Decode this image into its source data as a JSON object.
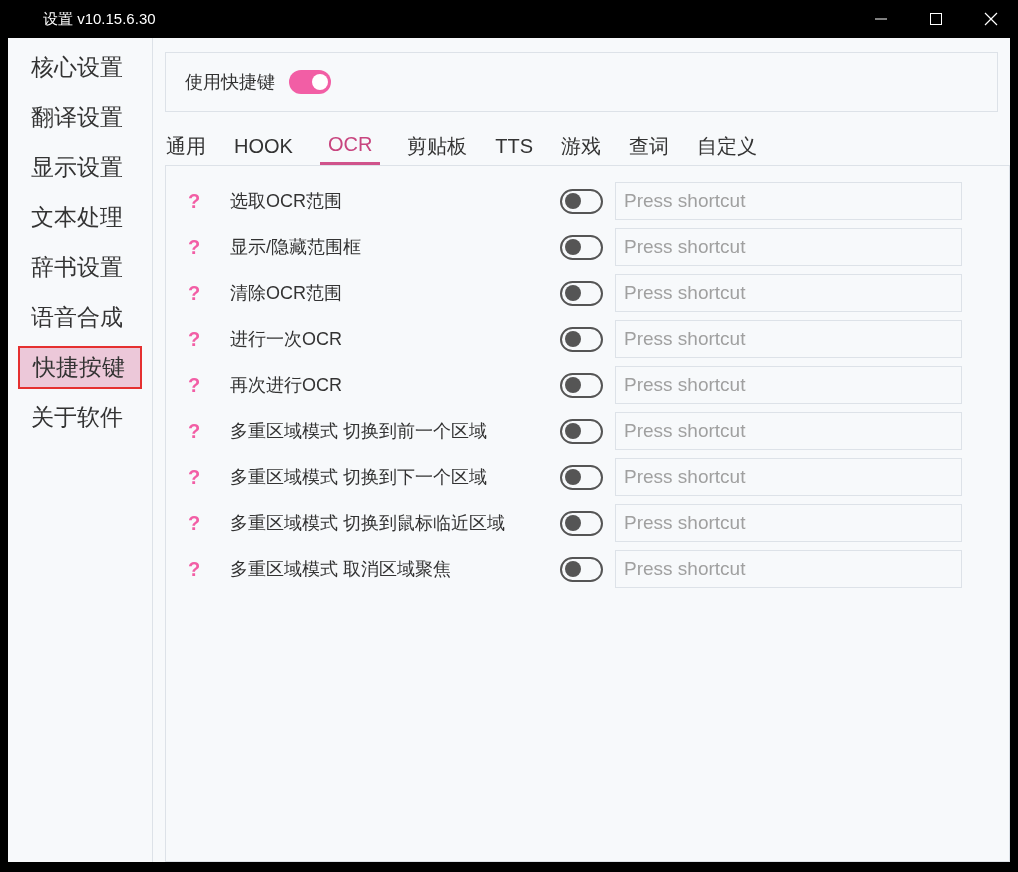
{
  "window": {
    "title": "设置 v10.15.6.30"
  },
  "sidebar": {
    "items": [
      {
        "label": "核心设置",
        "selected": false
      },
      {
        "label": "翻译设置",
        "selected": false
      },
      {
        "label": "显示设置",
        "selected": false
      },
      {
        "label": "文本处理",
        "selected": false
      },
      {
        "label": "辞书设置",
        "selected": false
      },
      {
        "label": "语音合成",
        "selected": false
      },
      {
        "label": "快捷按键",
        "selected": true
      },
      {
        "label": "关于软件",
        "selected": false
      }
    ]
  },
  "master_switch": {
    "label": "使用快捷键",
    "on": true
  },
  "tabs": [
    {
      "label": "通用",
      "selected": false
    },
    {
      "label": "HOOK",
      "selected": false
    },
    {
      "label": "OCR",
      "selected": true
    },
    {
      "label": "剪贴板",
      "selected": false
    },
    {
      "label": "TTS",
      "selected": false
    },
    {
      "label": "游戏",
      "selected": false
    },
    {
      "label": "查词",
      "selected": false
    },
    {
      "label": "自定义",
      "selected": false
    }
  ],
  "help_mark": "?",
  "shortcuts": [
    {
      "label": "选取OCR范围",
      "on": false,
      "placeholder": "Press shortcut"
    },
    {
      "label": "显示/隐藏范围框",
      "on": false,
      "placeholder": "Press shortcut"
    },
    {
      "label": "清除OCR范围",
      "on": false,
      "placeholder": "Press shortcut"
    },
    {
      "label": "进行一次OCR",
      "on": false,
      "placeholder": "Press shortcut"
    },
    {
      "label": "再次进行OCR",
      "on": false,
      "placeholder": "Press shortcut"
    },
    {
      "label": "多重区域模式 切换到前一个区域",
      "on": false,
      "placeholder": "Press shortcut"
    },
    {
      "label": "多重区域模式 切换到下一个区域",
      "on": false,
      "placeholder": "Press shortcut"
    },
    {
      "label": "多重区域模式 切换到鼠标临近区域",
      "on": false,
      "placeholder": "Press shortcut"
    },
    {
      "label": "多重区域模式 取消区域聚焦",
      "on": false,
      "placeholder": "Press shortcut"
    }
  ]
}
